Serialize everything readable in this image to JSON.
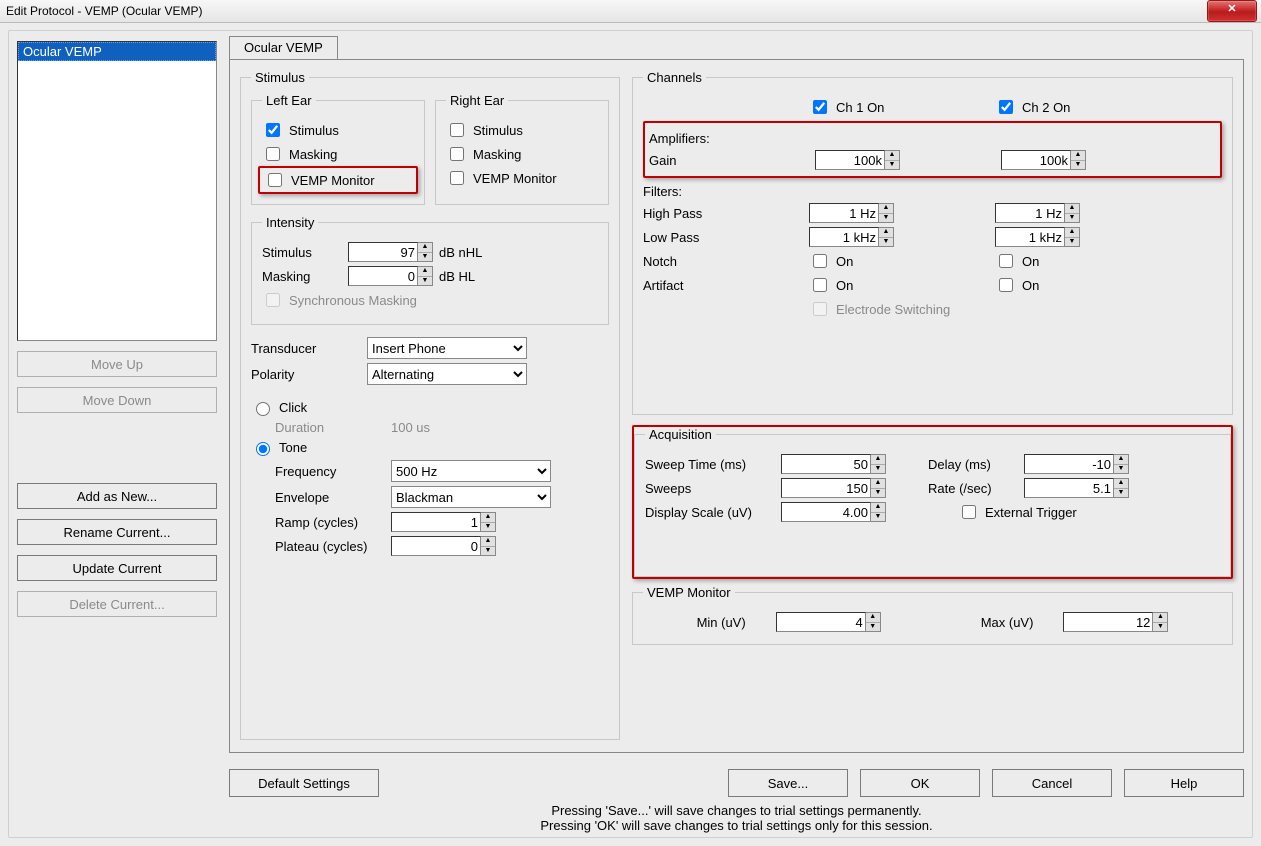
{
  "titlebar": {
    "title": "Edit Protocol - VEMP (Ocular VEMP)",
    "close_glyph": "✕"
  },
  "leftcol": {
    "list_item": "Ocular VEMP",
    "move_up": "Move Up",
    "move_down": "Move Down",
    "add_as_new": "Add as New...",
    "rename_current": "Rename Current...",
    "update_current": "Update Current",
    "delete_current": "Delete Current..."
  },
  "tab": {
    "label": "Ocular VEMP"
  },
  "stimulus": {
    "legend": "Stimulus",
    "left_ear": {
      "legend": "Left Ear",
      "stimulus": "Stimulus",
      "masking": "Masking",
      "vemp_monitor": "VEMP Monitor",
      "stimulus_checked": true,
      "masking_checked": false,
      "vemp_checked": false
    },
    "right_ear": {
      "legend": "Right Ear",
      "stimulus": "Stimulus",
      "masking": "Masking",
      "vemp_monitor": "VEMP Monitor",
      "stimulus_checked": false,
      "masking_checked": false,
      "vemp_checked": false
    },
    "intensity": {
      "legend": "Intensity",
      "stimulus_label": "Stimulus",
      "stimulus_value": "97",
      "stimulus_unit": "dB nHL",
      "masking_label": "Masking",
      "masking_value": "0",
      "masking_unit": "dB HL",
      "sync_masking": "Synchronous Masking",
      "sync_masking_checked": false
    },
    "transducer_label": "Transducer",
    "transducer_value": "Insert Phone",
    "polarity_label": "Polarity",
    "polarity_value": "Alternating",
    "mode_click": "Click",
    "mode_tone": "Tone",
    "mode_selected": "tone",
    "duration_label": "Duration",
    "duration_value": "100 us",
    "frequency_label": "Frequency",
    "frequency_value": "500 Hz",
    "envelope_label": "Envelope",
    "envelope_value": "Blackman",
    "ramp_label": "Ramp (cycles)",
    "ramp_value": "1",
    "plateau_label": "Plateau (cycles)",
    "plateau_value": "0"
  },
  "channels": {
    "legend": "Channels",
    "ch1": "Ch 1 On",
    "ch1_checked": true,
    "ch2": "Ch 2 On",
    "ch2_checked": true,
    "amplifiers": "Amplifiers:",
    "gain": "Gain",
    "gain1": "100k",
    "gain2": "100k",
    "filters": "Filters:",
    "high_pass": "High Pass",
    "hp1": "1 Hz",
    "hp2": "1 Hz",
    "low_pass": "Low Pass",
    "lp1": "1 kHz",
    "lp2": "1 kHz",
    "notch": "Notch",
    "on": "On",
    "artifact": "Artifact",
    "notch1": false,
    "notch2": false,
    "artifact1": false,
    "artifact2": false,
    "electrode_switching": "Electrode Switching",
    "electrode_switching_checked": false
  },
  "acquisition": {
    "legend": "Acquisition",
    "sweep_time": "Sweep Time (ms)",
    "sweep_time_val": "50",
    "delay": "Delay (ms)",
    "delay_val": "-10",
    "sweeps": "Sweeps",
    "sweeps_val": "150",
    "rate": "Rate (/sec)",
    "rate_val": "5.1",
    "display_scale": "Display Scale (uV)",
    "display_scale_val": "4.00",
    "ext_trigger": "External Trigger",
    "ext_trigger_checked": false
  },
  "vemp_monitor": {
    "legend": "VEMP Monitor",
    "min_label": "Min (uV)",
    "min_val": "4",
    "max_label": "Max (uV)",
    "max_val": "12"
  },
  "bottom": {
    "default_settings": "Default Settings",
    "save": "Save...",
    "ok": "OK",
    "cancel": "Cancel",
    "help": "Help",
    "line1": "Pressing 'Save...' will save changes to trial settings permanently.",
    "line2": "Pressing 'OK' will save changes to trial settings only for this session."
  }
}
